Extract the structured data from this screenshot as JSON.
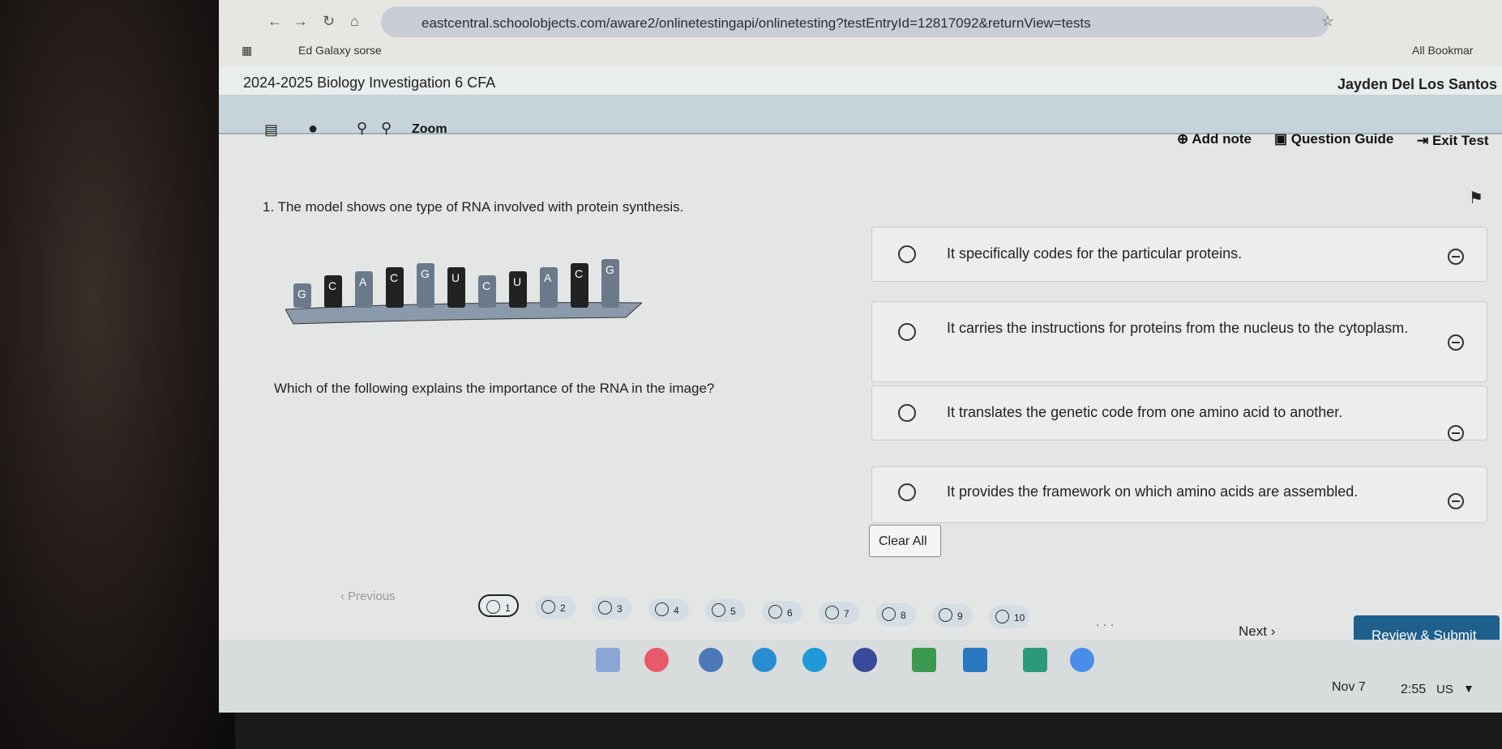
{
  "browser": {
    "url": "eastcentral.schoolobjects.com/aware2/onlinetestingapi/onlinetesting?testEntryId=12817092&returnView=tests",
    "bookmark": "Ed Galaxy sorse",
    "all_bookmarks": "All Bookmar"
  },
  "header": {
    "test_title": "2024-2025 Biology Investigation 6 CFA",
    "user": "Jayden Del Los Santos"
  },
  "toolbar": {
    "zoom": "Zoom",
    "add_note": "Add note",
    "question_guide": "Question Guide",
    "exit": "Exit Test"
  },
  "question": {
    "stem": "1. The model shows one type of RNA involved with protein synthesis.",
    "prompt": "Which of the following explains the importance of the RNA in the image?",
    "bases": [
      "G",
      "C",
      "A",
      "C",
      "G",
      "U",
      "C",
      "U",
      "A",
      "C",
      "G"
    ],
    "options": [
      "It specifically codes for the particular proteins.",
      "It carries the instructions for proteins from the nucleus to the cytoplasm.",
      "It translates the genetic code from one amino acid to another.",
      "It provides the framework on which amino acids are assembled."
    ],
    "clear_all": "Clear All"
  },
  "pagination": {
    "previous": "Previous",
    "pages": [
      "1",
      "2",
      "3",
      "4",
      "5",
      "6",
      "7",
      "8",
      "9",
      "10"
    ],
    "current": "1",
    "ellipsis": ". . .",
    "next": "Next",
    "review": "Review & Submit"
  },
  "taskbar": {
    "date": "Nov 7",
    "time": "2:55",
    "locale": "US"
  },
  "colors": {
    "accent": "#1e5f8c",
    "toolbar": "#c6d3da"
  }
}
